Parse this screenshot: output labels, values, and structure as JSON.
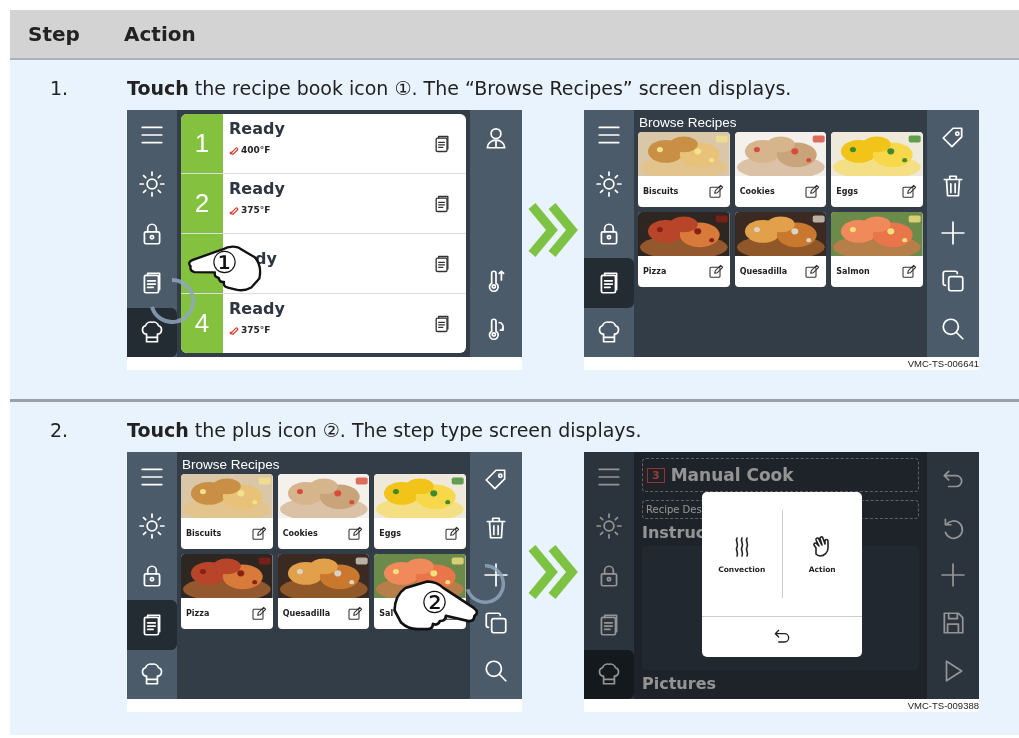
{
  "table": {
    "columns": [
      "Step",
      "Action"
    ]
  },
  "steps": [
    {
      "number": "1.",
      "instruction": "**Touch** the recipe book icon ①. The “Browse Recipes” screen displays.",
      "figure_id": "VMC-TS-006641",
      "screens": [
        {
          "kind": "ovens",
          "nav": [
            {
              "kind": "menu",
              "selected": false
            },
            {
              "kind": "sun",
              "selected": false
            },
            {
              "kind": "lock",
              "selected": false
            },
            {
              "kind": "recipe",
              "selected": false
            },
            {
              "kind": "chef",
              "selected": true
            }
          ],
          "ovens": [
            {
              "number": "1",
              "status": "Ready",
              "temperature": "400°F"
            },
            {
              "number": "2",
              "status": "Ready",
              "temperature": "375°F"
            },
            {
              "status": "dy"
            },
            {
              "number": "4",
              "status": "Ready",
              "temperature": "375°F"
            }
          ],
          "toolbar": [
            {
              "kind": "user"
            },
            {
              "kind": "thermo-up"
            },
            {
              "kind": "thermo-down"
            }
          ],
          "touch": {
            "label": "①"
          }
        },
        {
          "kind": "browse",
          "title": "Browse Recipes",
          "nav": [
            {
              "kind": "menu",
              "selected": false
            },
            {
              "kind": "sun",
              "selected": false
            },
            {
              "kind": "lock",
              "selected": false
            },
            {
              "kind": "recipe",
              "selected": true
            },
            {
              "kind": "chef",
              "selected": false
            }
          ],
          "recipes": [
            {
              "name": "Biscuits"
            },
            {
              "name": "Cookies"
            },
            {
              "name": "Eggs"
            },
            {
              "name": "Pizza"
            },
            {
              "name": "Quesadilla"
            },
            {
              "name": "Salmon"
            }
          ],
          "toolbar": [
            {
              "kind": "tag"
            },
            {
              "kind": "trash"
            },
            {
              "kind": "plus"
            },
            {
              "kind": "copy"
            },
            {
              "kind": "search"
            }
          ]
        }
      ]
    },
    {
      "number": "2.",
      "instruction": "**Touch** the plus icon ②. The step type screen displays.",
      "figure_id": "VMC-TS-009388",
      "screens": [
        {
          "kind": "browse",
          "title": "Browse Recipes",
          "nav": [
            {
              "kind": "menu",
              "selected": false
            },
            {
              "kind": "sun",
              "selected": false
            },
            {
              "kind": "lock",
              "selected": false
            },
            {
              "kind": "recipe",
              "selected": true
            },
            {
              "kind": "chef",
              "selected": false
            }
          ],
          "recipes": [
            {
              "name": "Biscuits"
            },
            {
              "name": "Cookies"
            },
            {
              "name": "Eggs"
            },
            {
              "name": "Pizza"
            },
            {
              "name": "Quesadilla"
            },
            {
              "name": "Sal"
            }
          ],
          "toolbar": [
            {
              "kind": "tag"
            },
            {
              "kind": "trash"
            },
            {
              "kind": "plus"
            },
            {
              "kind": "copy"
            },
            {
              "kind": "search"
            }
          ],
          "touch": {
            "label": "②"
          }
        },
        {
          "kind": "step_type",
          "nav": [
            {
              "kind": "menu",
              "selected": false
            },
            {
              "kind": "sun",
              "selected": false
            },
            {
              "kind": "lock",
              "selected": false
            },
            {
              "kind": "recipe",
              "selected": false
            },
            {
              "kind": "chef",
              "selected": true
            }
          ],
          "step_badge": "3",
          "step_title": "Manual Cook",
          "description_placeholder": "Recipe Des",
          "instructions_heading": "Instruc",
          "pictures_heading": "Pictures",
          "toolbar": [
            {
              "kind": "back"
            },
            {
              "kind": "undo"
            },
            {
              "kind": "plus"
            },
            {
              "kind": "save"
            },
            {
              "kind": "play"
            }
          ],
          "dialog": {
            "options": [
              {
                "kind": "convection",
                "label": "Convection"
              },
              {
                "kind": "hand",
                "label": "Action"
              }
            ]
          }
        }
      ]
    }
  ]
}
